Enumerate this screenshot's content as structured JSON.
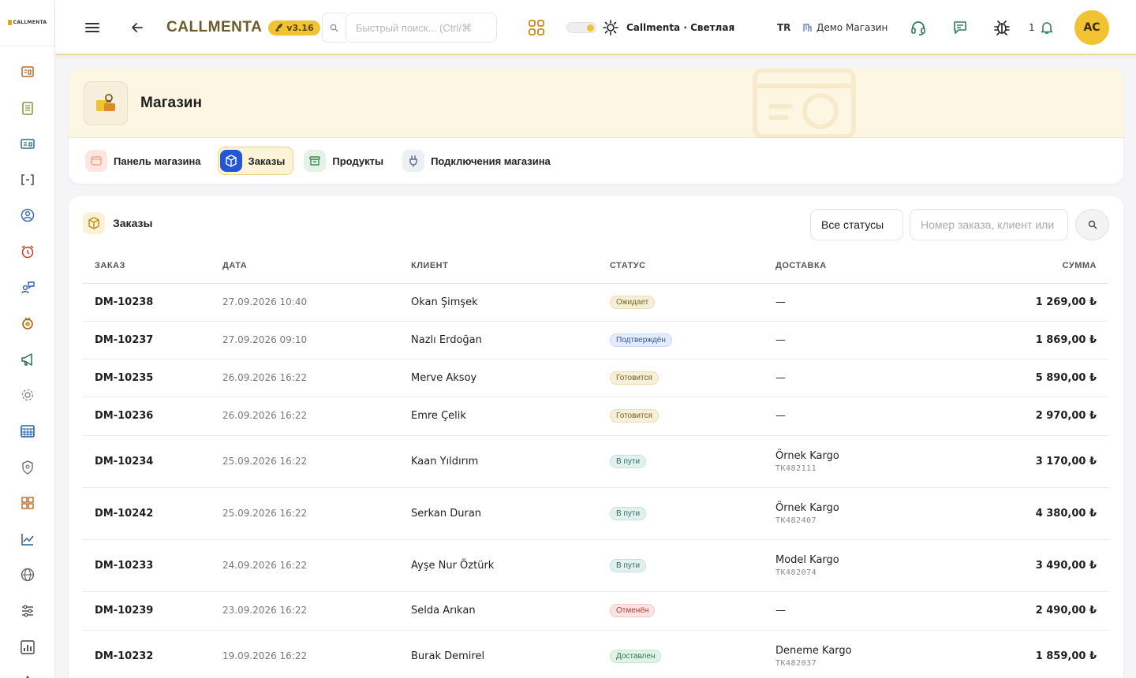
{
  "brand": {
    "logo_text": "CALLMENTA",
    "name": "CALLMENTA",
    "version": "v3.16"
  },
  "topbar": {
    "search_placeholder": "Быстрый поиск... (Ctrl/⌘",
    "theme_label": "Callmenta · Светлая",
    "language": "TR",
    "store_label": "Демо Магазин",
    "notification_count": "1",
    "avatar_initials": "AC"
  },
  "rail_icons": [
    "dashboard-icon",
    "clipboard-icon",
    "id-card-icon",
    "code-brackets-icon",
    "user-circle-icon",
    "alarm-icon",
    "agent-chat-icon",
    "medal-icon",
    "megaphone-icon",
    "gear-badge-icon",
    "grid-calendar-icon",
    "shield-icon",
    "boxes-icon",
    "line-chart-icon",
    "globe-icon",
    "sliders-icon",
    "bar-chart-icon",
    "triangle-icon"
  ],
  "store": {
    "title": "Магазин",
    "tabs": [
      {
        "label": "Панель магазина",
        "icon": "store-panel-icon",
        "color": "#e7a58c",
        "bg": "#fbe7df",
        "active": false
      },
      {
        "label": "Заказы",
        "icon": "box-icon",
        "color": "#ffffff",
        "bg": "#2357d6",
        "active": true
      },
      {
        "label": "Продукты",
        "icon": "archive-icon",
        "color": "#3a8a52",
        "bg": "#e6f2e7",
        "active": false
      },
      {
        "label": "Подключения магазина",
        "icon": "plug-icon",
        "color": "#5a6a80",
        "bg": "#eceff3",
        "active": false
      }
    ]
  },
  "orders": {
    "title": "Заказы",
    "status_filter": "Все статусы",
    "search_placeholder": "Номер заказа, клиент или",
    "columns": {
      "order": "ЗАКАЗ",
      "date": "ДАТА",
      "client": "КЛИЕНТ",
      "status": "СТАТУС",
      "delivery": "ДОСТАВКА",
      "sum": "СУММА"
    },
    "rows": [
      {
        "id": "DM-10238",
        "date": "27.09.2026 10:40",
        "client": "Okan Şimşek",
        "status": "Ожидает",
        "status_kind": "pending",
        "delivery": "—",
        "tracking": "",
        "sum": "1 269,00 ₺"
      },
      {
        "id": "DM-10237",
        "date": "27.09.2026 09:10",
        "client": "Nazlı Erdoğan",
        "status": "Подтверждён",
        "status_kind": "confirmed",
        "delivery": "—",
        "tracking": "",
        "sum": "1 869,00 ₺"
      },
      {
        "id": "DM-10235",
        "date": "26.09.2026 16:22",
        "client": "Merve Aksoy",
        "status": "Готовится",
        "status_kind": "preparing",
        "delivery": "—",
        "tracking": "",
        "sum": "5 890,00 ₺"
      },
      {
        "id": "DM-10236",
        "date": "26.09.2026 16:22",
        "client": "Emre Çelik",
        "status": "Готовится",
        "status_kind": "preparing",
        "delivery": "—",
        "tracking": "",
        "sum": "2 970,00 ₺"
      },
      {
        "id": "DM-10234",
        "date": "25.09.2026 16:22",
        "client": "Kaan Yıldırım",
        "status": "В пути",
        "status_kind": "transit",
        "delivery": "Örnek Kargo",
        "tracking": "TK482111",
        "sum": "3 170,00 ₺"
      },
      {
        "id": "DM-10242",
        "date": "25.09.2026 16:22",
        "client": "Serkan Duran",
        "status": "В пути",
        "status_kind": "transit",
        "delivery": "Örnek Kargo",
        "tracking": "TK482407",
        "sum": "4 380,00 ₺"
      },
      {
        "id": "DM-10233",
        "date": "24.09.2026 16:22",
        "client": "Ayşe Nur Öztürk",
        "status": "В пути",
        "status_kind": "transit",
        "delivery": "Model Kargo",
        "tracking": "TK482074",
        "sum": "3 490,00 ₺"
      },
      {
        "id": "DM-10239",
        "date": "23.09.2026 16:22",
        "client": "Selda Arıkan",
        "status": "Отменён",
        "status_kind": "cancelled",
        "delivery": "—",
        "tracking": "",
        "sum": "2 490,00 ₺"
      },
      {
        "id": "DM-10232",
        "date": "19.09.2026 16:22",
        "client": "Burak Demirel",
        "status": "Доставлен",
        "status_kind": "delivered",
        "delivery": "Deneme Kargo",
        "tracking": "TK482037",
        "sum": "1 859,00 ₺"
      }
    ]
  },
  "status_colors": {
    "pending": {
      "bg": "#f6efd9",
      "fg": "#7a6422",
      "border": "#ecdcae"
    },
    "confirmed": {
      "bg": "#e4ecfd",
      "fg": "#3457b5",
      "border": "#c9d7fa"
    },
    "preparing": {
      "bg": "#f6efd9",
      "fg": "#7a6422",
      "border": "#ecdcae"
    },
    "transit": {
      "bg": "#e3f1ee",
      "fg": "#2f6f63",
      "border": "#c6e2db"
    },
    "cancelled": {
      "bg": "#fbe4e3",
      "fg": "#b23a35",
      "border": "#f3c9c6"
    },
    "delivered": {
      "bg": "#e1f3e8",
      "fg": "#2f7a4c",
      "border": "#c3e6cf"
    }
  }
}
